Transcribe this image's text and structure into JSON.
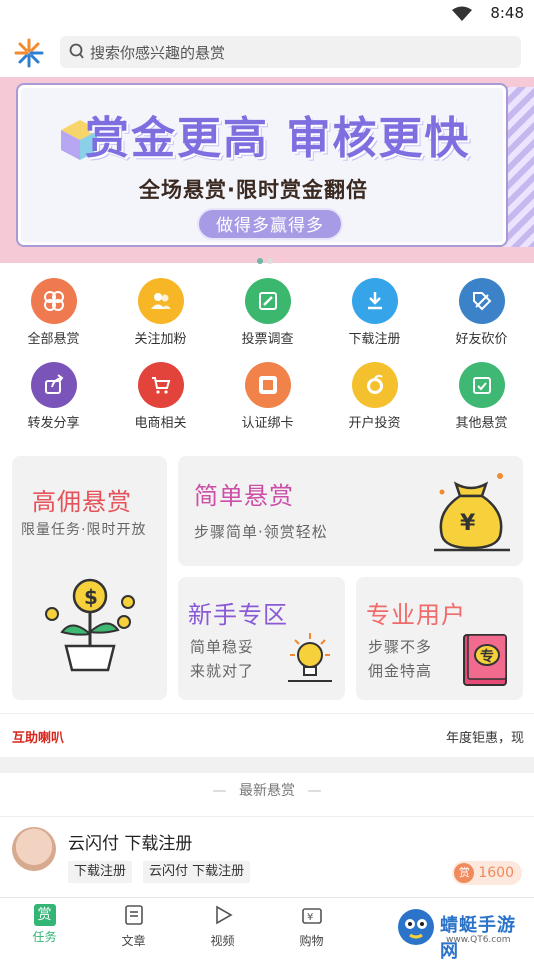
{
  "status_bar": {
    "time": "8:48"
  },
  "search": {
    "placeholder": "搜索你感兴趣的悬赏"
  },
  "banner": {
    "title": "赏金更高 审核更快",
    "subtitle": "全场悬赏·限时赏金翻倍",
    "button": "做得多赢得多",
    "page_count": 2,
    "active_page": 1
  },
  "categories": [
    {
      "label": "全部悬赏",
      "icon": "clover-icon",
      "color": "#f07a4f"
    },
    {
      "label": "关注加粉",
      "icon": "users-icon",
      "color": "#f6b625"
    },
    {
      "label": "投票调查",
      "icon": "pencil-icon",
      "color": "#3cb86e"
    },
    {
      "label": "下载注册",
      "icon": "download-icon",
      "color": "#35a4e8"
    },
    {
      "label": "好友砍价",
      "icon": "tag-icon",
      "color": "#3b82c9"
    },
    {
      "label": "转发分享",
      "icon": "share-icon",
      "color": "#7a54b8"
    },
    {
      "label": "电商相关",
      "icon": "cart-icon",
      "color": "#e2443c"
    },
    {
      "label": "认证绑卡",
      "icon": "taobao-icon",
      "color": "#f0824a"
    },
    {
      "label": "开户投资",
      "icon": "orange-icon",
      "color": "#f5c02e"
    },
    {
      "label": "其他悬赏",
      "icon": "calendar-check-icon",
      "color": "#3fb874"
    }
  ],
  "features": {
    "high": {
      "title": "高佣悬赏",
      "sub": "限量任务·限时开放",
      "color": "#e5525a"
    },
    "simple": {
      "title": "简单悬赏",
      "sub": "步骤简单·领赏轻松",
      "color": "#cc4fa7"
    },
    "newbie": {
      "title": "新手专区",
      "sub1": "简单稳妥",
      "sub2": "来就对了",
      "color": "#8a5ad6"
    },
    "pro": {
      "title": "专业用户",
      "sub1": "步骤不多",
      "sub2": "佣金特高",
      "color": "#f06b6b"
    }
  },
  "ticker": {
    "left": "互助喇叭",
    "right": "年度钜惠，现"
  },
  "latest": {
    "label": "最新悬赏"
  },
  "item": {
    "title": "云闪付 下载注册",
    "tags": [
      "下载注册",
      "云闪付 下载注册"
    ],
    "reward_badge": "赏",
    "reward": "1600"
  },
  "nav": [
    {
      "label": "任务",
      "icon": "reward-icon",
      "active": true
    },
    {
      "label": "文章",
      "icon": "article-icon",
      "active": false
    },
    {
      "label": "视频",
      "icon": "play-icon",
      "active": false
    },
    {
      "label": "购物",
      "icon": "shopping-icon",
      "active": false
    }
  ],
  "watermark": {
    "title": "蜻蜓手游网",
    "url": "www.QT6.com"
  }
}
